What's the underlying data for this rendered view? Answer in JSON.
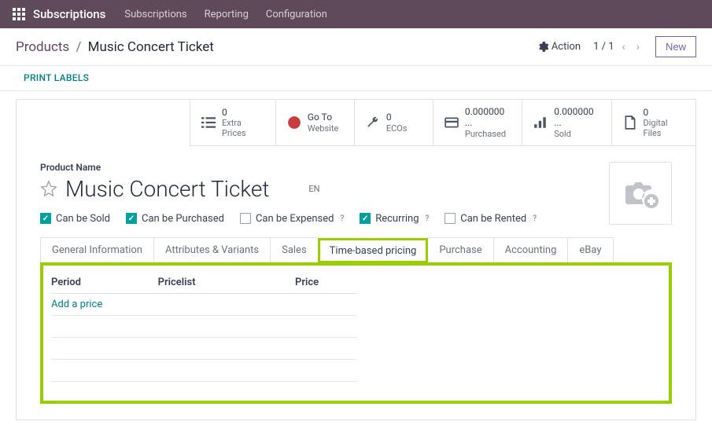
{
  "topbar": {
    "brand": "Subscriptions",
    "nav": [
      "Subscriptions",
      "Reporting",
      "Configuration"
    ]
  },
  "breadcrumb": {
    "root": "Products",
    "current": "Music Concert Ticket"
  },
  "actions": {
    "action_label": "Action",
    "pager": "1 / 1",
    "new_label": "New"
  },
  "print_labels": "PRINT LABELS",
  "stats": [
    {
      "value": "0",
      "label": "Extra Prices"
    },
    {
      "value": "Go To",
      "label": "Website"
    },
    {
      "value": "0",
      "label": "ECOs"
    },
    {
      "value": "0.000000 ...",
      "label": "Purchased"
    },
    {
      "value": "0.000000 ...",
      "label": "Sold"
    },
    {
      "value": "0",
      "label": "Digital Files"
    }
  ],
  "product": {
    "name_label": "Product Name",
    "name": "Music Concert Ticket",
    "lang": "EN"
  },
  "checks": {
    "sold": "Can be Sold",
    "purchased": "Can be Purchased",
    "expensed": "Can be Expensed",
    "recurring": "Recurring",
    "rented": "Can be Rented"
  },
  "tabs": [
    "General Information",
    "Attributes & Variants",
    "Sales",
    "Time-based pricing",
    "Purchase",
    "Accounting",
    "eBay"
  ],
  "pricing": {
    "headers": {
      "period": "Period",
      "pricelist": "Pricelist",
      "price": "Price"
    },
    "add": "Add a price"
  }
}
